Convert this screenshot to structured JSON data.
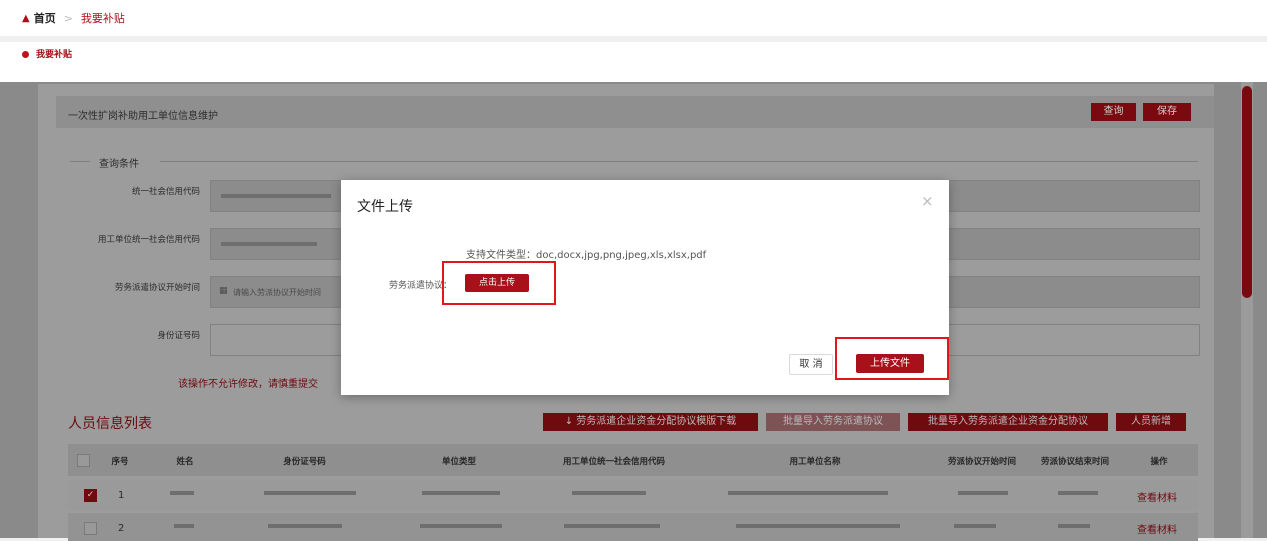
{
  "breadcrumb": {
    "home": "首页",
    "current": "我要补贴"
  },
  "subheader": {
    "title": "我要补贴"
  },
  "panel": {
    "title": "一次性扩岗补助用工单位信息维护",
    "query_label": "查询",
    "save_label": "保存"
  },
  "query_section": {
    "title": "查询条件",
    "fields": [
      {
        "label": "统一社会信用代码"
      },
      {
        "label": "用工单位统一社会信用代码"
      },
      {
        "label": "劳务派遣协议开始时间",
        "placeholder": "请输入劳派协议开始时间"
      },
      {
        "label": "身份证号码"
      }
    ],
    "warning": "该操作不允许修改，请慎重提交"
  },
  "list": {
    "title": "人员信息列表",
    "buttons": {
      "template_download": "劳务派遣企业资金分配协议模版下载",
      "import_agreement": "批量导入劳务派遣协议",
      "import_allocation": "批量导入劳务派遣企业资金分配协议",
      "add_person": "人员新增"
    },
    "columns": [
      "序号",
      "姓名",
      "身份证号码",
      "单位类型",
      "用工单位统一社会信用代码",
      "用工单位名称",
      "劳派协议开始时间",
      "劳派协议结束时间",
      "操作"
    ],
    "rows": [
      {
        "index": "1",
        "checked": true,
        "action": "查看材料"
      },
      {
        "index": "2",
        "checked": false,
        "action": "查看材料"
      }
    ]
  },
  "modal": {
    "title": "文件上传",
    "close": "×",
    "supported_types": "支持文件类型：doc,docx,jpg,png,jpeg,xls,xlsx,pdf",
    "field_label": "劳务派遣协议：",
    "choose_label": "点击上传",
    "cancel_label": "取 消",
    "submit_label": "上传文件"
  },
  "colors": {
    "brand": "#a8111a",
    "highlight": "#e4151f"
  },
  "icons": {
    "home": "home-icon",
    "calendar": "calendar-icon",
    "download": "download-icon",
    "check": "check-icon",
    "close": "close-icon"
  }
}
